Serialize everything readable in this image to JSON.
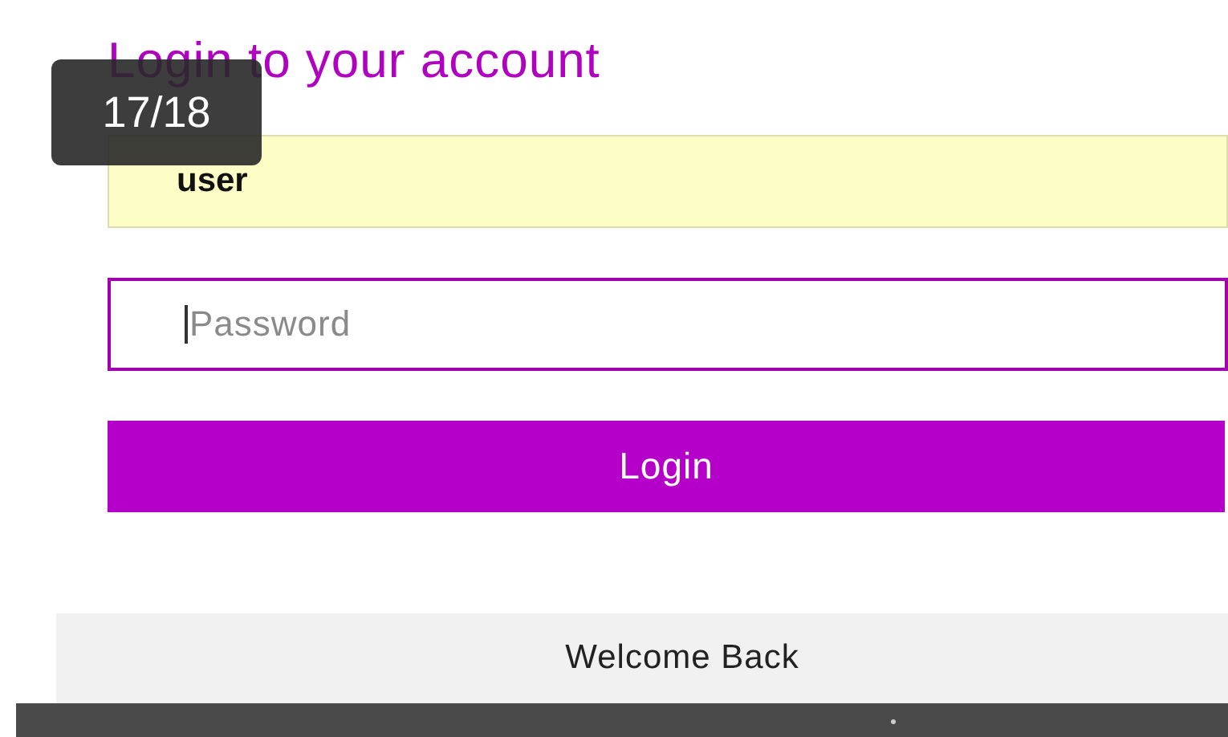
{
  "title": "Login to your account",
  "page_counter": "17/18",
  "username": {
    "value": "user",
    "autofilled": true
  },
  "password": {
    "placeholder": "Password",
    "focused": true
  },
  "login_button": "Login",
  "footer": {
    "text": "Welcome Back"
  }
}
